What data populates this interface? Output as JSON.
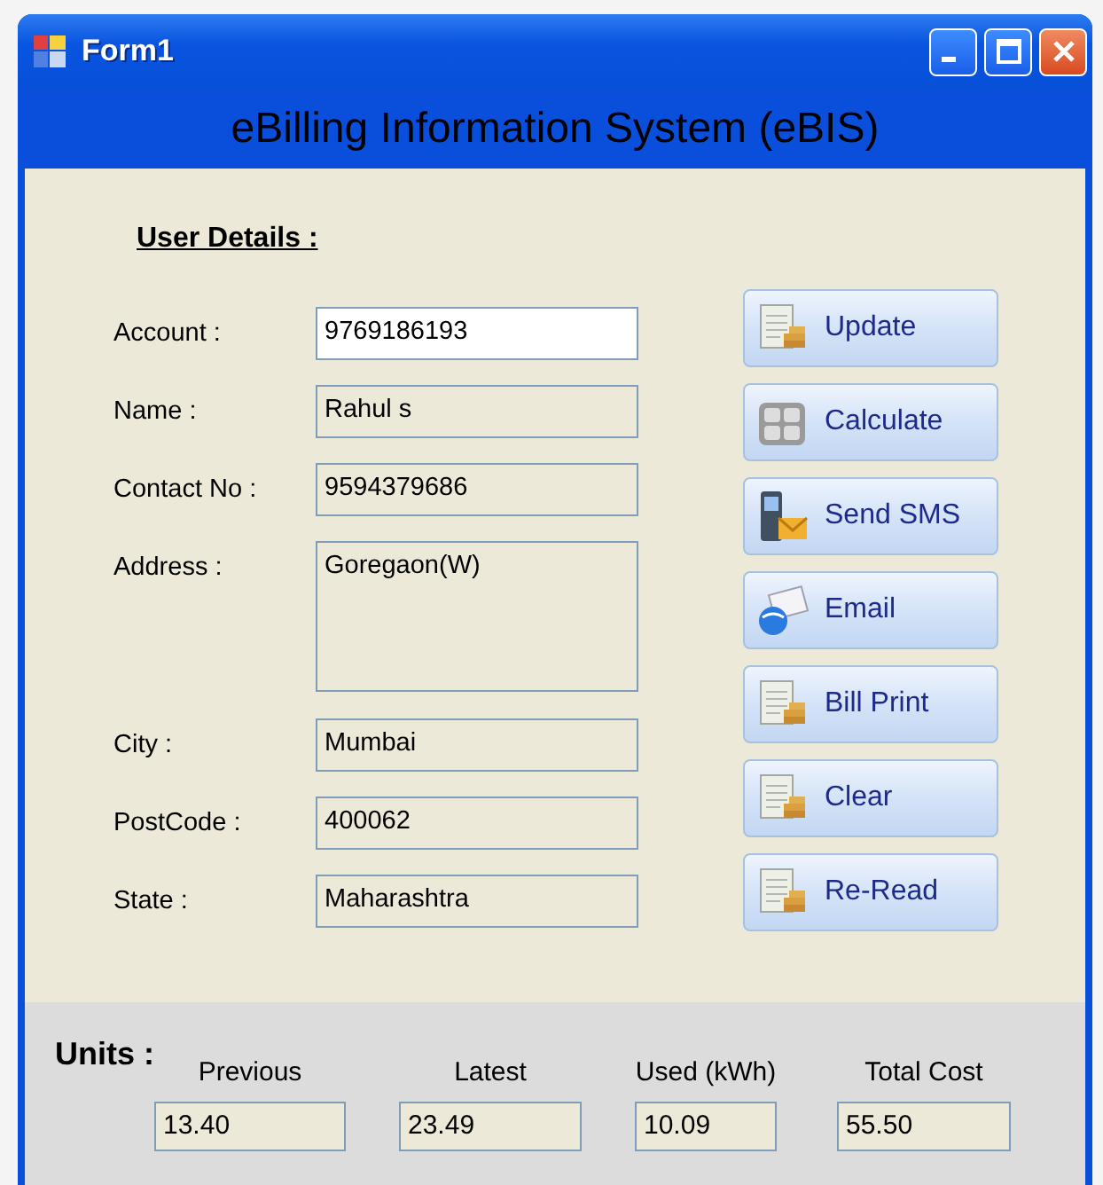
{
  "window": {
    "title": "Form1"
  },
  "header": "eBilling Information System (eBIS)",
  "section_title": "User Details :",
  "fields": [
    {
      "label": "Account :",
      "value": "9769186193",
      "readonly": false,
      "kind": "line"
    },
    {
      "label": "Name :",
      "value": "Rahul s",
      "readonly": true,
      "kind": "line"
    },
    {
      "label": "Contact No :",
      "value": "9594379686",
      "readonly": true,
      "kind": "line"
    },
    {
      "label": "Address :",
      "value": "Goregaon(W)",
      "readonly": true,
      "kind": "multiline"
    },
    {
      "label": "City :",
      "value": "Mumbai",
      "readonly": true,
      "kind": "line"
    },
    {
      "label": "PostCode :",
      "value": "400062",
      "readonly": true,
      "kind": "line"
    },
    {
      "label": "State :",
      "value": "Maharashtra",
      "readonly": true,
      "kind": "line"
    }
  ],
  "buttons": [
    {
      "label": "Update",
      "kind": "bill"
    },
    {
      "label": "Calculate",
      "kind": "calculator"
    },
    {
      "label": "Send SMS",
      "kind": "phone"
    },
    {
      "label": "Email",
      "kind": "email"
    },
    {
      "label": "Bill Print",
      "kind": "bill"
    },
    {
      "label": "Clear",
      "kind": "bill"
    },
    {
      "label": "Re-Read",
      "kind": "bill"
    }
  ],
  "units": {
    "title": "Units :",
    "columns": [
      {
        "label": "Previous",
        "value": "13.40"
      },
      {
        "label": "Latest",
        "value": "23.49"
      },
      {
        "label": "Used (kWh)",
        "value": "10.09"
      },
      {
        "label": "Total Cost",
        "value": "55.50"
      }
    ]
  }
}
